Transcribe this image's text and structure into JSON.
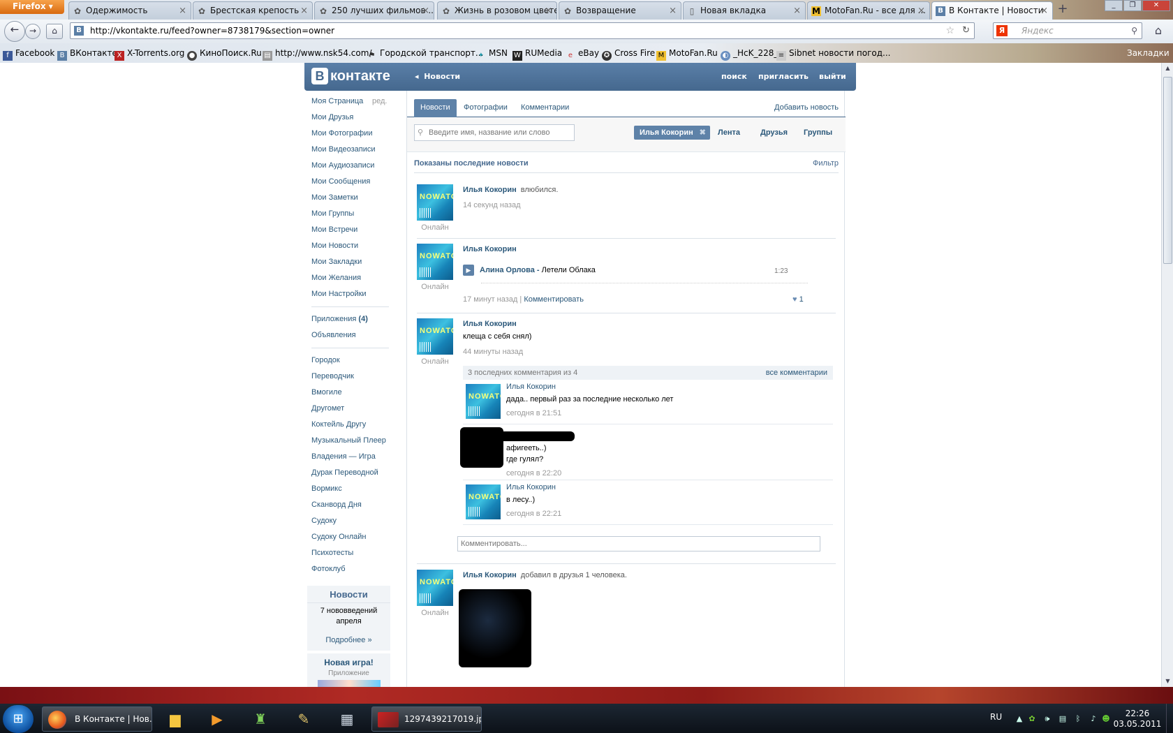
{
  "browser": {
    "menu_label": "Firefox",
    "tabs": [
      {
        "label": "Одержимость",
        "icon": "vk-icon"
      },
      {
        "label": "Брестская крепость",
        "icon": "vk-icon"
      },
      {
        "label": "250 лучших фильмов ...",
        "icon": "vk-icon"
      },
      {
        "label": "Жизнь в розовом цвете",
        "icon": "vk-icon"
      },
      {
        "label": "Возвращение",
        "icon": "vk-icon"
      },
      {
        "label": "Новая вкладка",
        "icon": "page-icon"
      },
      {
        "label": "MotoFan.Ru - все для ...",
        "icon": "motofan-icon"
      },
      {
        "label": "В Контакте | Новости",
        "icon": "vk-icon",
        "active": true
      }
    ],
    "url": "http://vkontakte.ru/feed?owner=8738179&section=owner",
    "search_placeholder": "Яндекс",
    "search_logo": "Я",
    "bookmarks": [
      {
        "label": "Facebook",
        "icon": "facebook-icon"
      },
      {
        "label": "ВКонтакте",
        "icon": "vk-icon"
      },
      {
        "label": "X-Torrents.org",
        "icon": "torrent-icon"
      },
      {
        "label": "КиноПоиск.Ru",
        "icon": "film-icon"
      },
      {
        "label": "http://www.nsk54.com/",
        "icon": "page-icon"
      },
      {
        "label": "Городской транспорт...",
        "icon": "bus-icon"
      },
      {
        "label": "MSN",
        "icon": "msn-icon"
      },
      {
        "label": "RUMedia",
        "icon": "rumedia-icon"
      },
      {
        "label": "eBay",
        "icon": "ebay-icon"
      },
      {
        "label": "Cross Fire",
        "icon": "crossfire-icon"
      },
      {
        "label": "MotoFan.Ru",
        "icon": "motofan-icon"
      },
      {
        "label": "_HcK_228_",
        "icon": "user-icon"
      },
      {
        "label": "Sibnet новости погод...",
        "icon": "sibnet-icon"
      }
    ],
    "bookmarks_menu": "Закладки"
  },
  "vk": {
    "logo": "контакте",
    "logo_mark": "В",
    "back_link": "Новости",
    "top_links": {
      "search": "поиск",
      "invite": "пригласить",
      "logout": "выйти"
    },
    "sidebar": {
      "edit": "ред.",
      "menu": [
        "Моя Страница",
        "Мои Друзья",
        "Мои Фотографии",
        "Мои Видеозаписи",
        "Мои Аудиозаписи",
        "Мои Сообщения",
        "Мои Заметки",
        "Мои Группы",
        "Мои Встречи",
        "Мои Новости",
        "Мои Закладки",
        "Мои Желания",
        "Мои Настройки"
      ],
      "apps_label": "Приложения",
      "apps_count": "(4)",
      "ads": "Объявления",
      "apps": [
        "Городок",
        "Переводчик",
        "Вмогиле",
        "Другомет",
        "Коктейль Другу",
        "Музыкальный Плеер",
        "Владения — Игра",
        "Дурак Переводной",
        "Вормикс",
        "Сканворд Дня",
        "Судоку",
        "Судоку Онлайн",
        "Психотесты",
        "Фотоклуб"
      ],
      "news_box": {
        "title": "Новости",
        "text": "7 нововведений апреля",
        "more": "Подробнее »"
      },
      "game_box": {
        "title": "Новая игра!",
        "subtitle": "Приложение"
      }
    },
    "tabs": [
      "Новости",
      "Фотографии",
      "Комментарии"
    ],
    "add_news": "Добавить новость",
    "search_placeholder": "Введите имя, название или слово",
    "owner_chip": "Илья Кокорин",
    "filter_links": [
      "Лента",
      "Друзья",
      "Группы"
    ],
    "shown_title": "Показаны последние новости",
    "filter_link": "Фильтр",
    "online": "Онлайн",
    "posts": [
      {
        "author": "Илья Кокорин",
        "action": "влюбился.",
        "time": "14 секунд назад"
      },
      {
        "author": "Илья Кокорин",
        "audio_artist": "Алина Орлова",
        "audio_title": "Летели Облака",
        "duration": "1:23",
        "time": "17 минут назад",
        "comment_link": "Комментировать",
        "likes": "1"
      },
      {
        "author": "Илья Кокорин",
        "text": "клеща с себя снял)",
        "time": "44 минуты назад",
        "comments_head": "3 последних комментария из 4",
        "all_comments": "все комментарии",
        "comments": [
          {
            "author": "Илья Кокорин",
            "text": "дада.. первый раз за последние несколько лет",
            "time": "сегодня в 21:51"
          },
          {
            "author": "",
            "text": "афигееть..)",
            "text2": "где гулял?",
            "time": "сегодня в 22:20"
          },
          {
            "author": "Илья Кокорин",
            "text": "в лесу..)",
            "time": "сегодня в 22:21"
          }
        ],
        "comment_placeholder": "Комментировать..."
      },
      {
        "author": "Илья Кокорин",
        "action": "добавил в друзья 1 человека."
      }
    ]
  },
  "taskbar": {
    "items": [
      {
        "label": "В Контакте | Нов...",
        "icon": "firefox-icon"
      },
      {
        "label": "1297439217019.jp...",
        "icon": "image-viewer-icon"
      }
    ],
    "lang": "RU",
    "time": "22:26",
    "date": "03.05.2011"
  }
}
